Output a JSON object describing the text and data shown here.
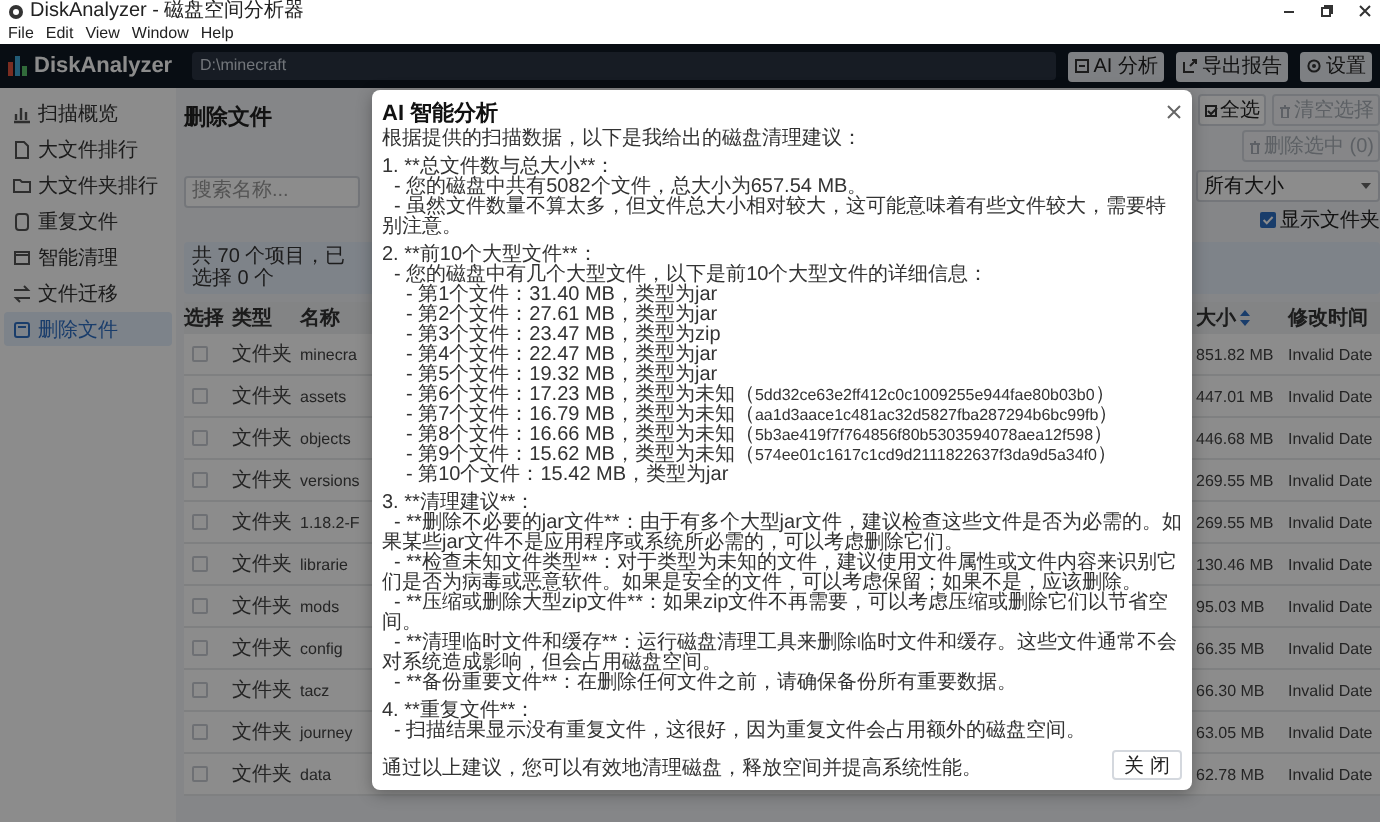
{
  "window": {
    "title": "DiskAnalyzer - 磁盘空间分析器"
  },
  "menu": [
    "File",
    "Edit",
    "View",
    "Window",
    "Help"
  ],
  "header": {
    "app_name": "DiskAnalyzer",
    "path": "D:\\minecraft",
    "buttons": [
      "AI 分析",
      "导出报告",
      "设置"
    ]
  },
  "sidebar": {
    "items": [
      {
        "label": "扫描概览",
        "selected": false
      },
      {
        "label": "大文件排行",
        "selected": false
      },
      {
        "label": "大文件夹排行",
        "selected": false
      },
      {
        "label": "重复文件",
        "selected": false
      },
      {
        "label": "智能清理",
        "selected": false
      },
      {
        "label": "文件迁移",
        "selected": false
      },
      {
        "label": "删除文件",
        "selected": true
      }
    ]
  },
  "page": {
    "title": "删除文件",
    "actions": [
      {
        "label": "全选",
        "disabled": false
      },
      {
        "label": "清空选择",
        "disabled": true
      },
      {
        "label": "删除选中 (0)",
        "disabled": true
      }
    ],
    "search": {
      "placeholder": "搜索名称..."
    },
    "size_filter": "所有大小",
    "show_folders": {
      "label": "显示文件夹",
      "checked": true
    },
    "summary": "共 70 个项目，已选择 0 个"
  },
  "table": {
    "columns": [
      {
        "label": "选择",
        "sorted": false
      },
      {
        "label": "类型",
        "sorted": false
      },
      {
        "label": "名称",
        "sorted": false
      },
      {
        "label": "大小",
        "sorted": true
      },
      {
        "label": "修改时间",
        "sorted": false
      }
    ],
    "rows": [
      {
        "checked": false,
        "type": "文件夹",
        "name": "minecra",
        "size": "851.82 MB",
        "modified": "Invalid Date"
      },
      {
        "checked": false,
        "type": "文件夹",
        "name": "assets",
        "size": "447.01 MB",
        "modified": "Invalid Date"
      },
      {
        "checked": false,
        "type": "文件夹",
        "name": "objects",
        "size": "446.68 MB",
        "modified": "Invalid Date"
      },
      {
        "checked": false,
        "type": "文件夹",
        "name": "versions",
        "size": "269.55 MB",
        "modified": "Invalid Date"
      },
      {
        "checked": false,
        "type": "文件夹",
        "name": "1.18.2-F",
        "size": "269.55 MB",
        "modified": "Invalid Date"
      },
      {
        "checked": false,
        "type": "文件夹",
        "name": "librarie",
        "size": "130.46 MB",
        "modified": "Invalid Date"
      },
      {
        "checked": false,
        "type": "文件夹",
        "name": "mods",
        "size": "95.03 MB",
        "modified": "Invalid Date"
      },
      {
        "checked": false,
        "type": "文件夹",
        "name": "config",
        "size": "66.35 MB",
        "modified": "Invalid Date"
      },
      {
        "checked": false,
        "type": "文件夹",
        "name": "tacz",
        "size": "66.30 MB",
        "modified": "Invalid Date"
      },
      {
        "checked": false,
        "type": "文件夹",
        "name": "journey",
        "size": "63.05 MB",
        "modified": "Invalid Date"
      },
      {
        "checked": false,
        "type": "文件夹",
        "name": "data",
        "size": "62.78 MB",
        "modified": "Invalid Date"
      }
    ]
  },
  "dialog": {
    "title": "AI 智能分析",
    "intro": "根据提供的扫描数据，以下是我给出的磁盘清理建议：",
    "sections": [
      {
        "heading": "1. **总文件数与总大小**：",
        "items": [
          {
            "text": "- 您的磁盘中共有5082个文件，总大小为657.54 MB。"
          },
          {
            "text": "- 虽然文件数量不算太多，但文件总大小相对较大，这可能意味着有些文件较大，需要特别注意。"
          }
        ]
      },
      {
        "heading": "2. **前10个大型文件**：",
        "items": [
          {
            "text": "- 您的磁盘中有几个大型文件，以下是前10个大型文件的详细信息：",
            "children": [
              {
                "text": "- 第1个文件：31.40 MB，类型为jar"
              },
              {
                "text": "- 第2个文件：27.61 MB，类型为jar"
              },
              {
                "text": "- 第3个文件：23.47 MB，类型为zip"
              },
              {
                "text": "- 第4个文件：22.47 MB，类型为jar"
              },
              {
                "text": "- 第5个文件：19.32 MB，类型为jar"
              },
              {
                "text": "- 第6个文件：17.23 MB，类型为未知（",
                "hash": "5dd32ce63e2ff412c0c1009255e944fae80b03b0",
                "suffix": "）"
              },
              {
                "text": "- 第7个文件：16.79 MB，类型为未知（",
                "hash": "aa1d3aace1c481ac32d5827fba287294b6bc99fb",
                "suffix": "）"
              },
              {
                "text": "- 第8个文件：16.66 MB，类型为未知（",
                "hash": "5b3ae419f7f764856f80b5303594078aea12f598",
                "suffix": "）"
              },
              {
                "text": "- 第9个文件：15.62 MB，类型为未知（",
                "hash": "574ee01c1617c1cd9d2111822637f3da9d5a34f0",
                "suffix": "）"
              },
              {
                "text": "- 第10个文件：15.42 MB，类型为jar"
              }
            ]
          }
        ]
      },
      {
        "heading": "3. **清理建议**：",
        "items": [
          {
            "text": "- **删除不必要的jar文件**：由于有多个大型jar文件，建议检查这些文件是否为必需的。如果某些jar文件不是应用程序或系统所必需的，可以考虑删除它们。"
          },
          {
            "text": "- **检查未知文件类型**：对于类型为未知的文件，建议使用文件属性或文件内容来识别它们是否为病毒或恶意软件。如果是安全的文件，可以考虑保留；如果不是，应该删除。"
          },
          {
            "text": "- **压缩或删除大型zip文件**：如果zip文件不再需要，可以考虑压缩或删除它们以节省空间。"
          },
          {
            "text": "- **清理临时文件和缓存**：运行磁盘清理工具来删除临时文件和缓存。这些文件通常不会对系统造成影响，但会占用磁盘空间。"
          },
          {
            "text": "- **备份重要文件**：在删除任何文件之前，请确保备份所有重要数据。"
          }
        ]
      },
      {
        "heading": "4. **重复文件**：",
        "items": [
          {
            "text": "- 扫描结果显示没有重复文件，这很好，因为重复文件会占用额外的磁盘空间。"
          }
        ]
      }
    ],
    "conclusion": "通过以上建议，您可以有效地清理磁盘，释放空间并提高系统性能。",
    "close_button": "关 闭"
  }
}
